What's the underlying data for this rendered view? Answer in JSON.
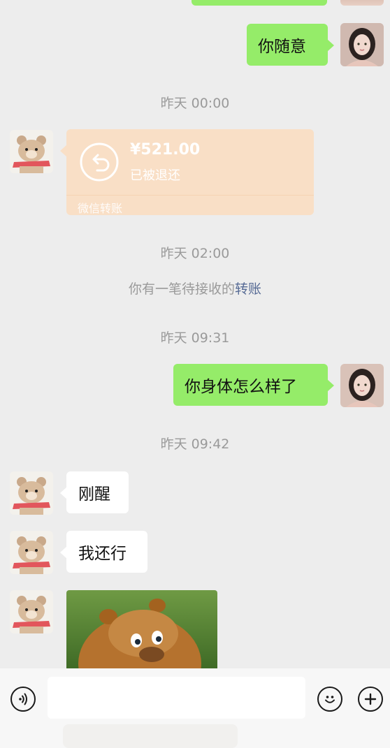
{
  "messages": {
    "me_1": "你随意",
    "me_2": "你身体怎么样了",
    "them_1": "刚醒",
    "them_2": "我还行"
  },
  "timestamps": {
    "t1": "昨天 00:00",
    "t2": "昨天 02:00",
    "t3": "昨天 09:31",
    "t4": "昨天 09:42"
  },
  "transfer": {
    "amount": "¥521.00",
    "status": "已被退还",
    "footer": "微信转账"
  },
  "system_notice": {
    "prefix": "你有一笔待接收的",
    "link": "转账"
  },
  "icons": {
    "voice": "voice-icon",
    "emoji": "emoji-icon",
    "plus": "plus-icon",
    "refund": "refund-arrow-icon"
  },
  "colors": {
    "my_bubble": "#95EC69",
    "their_bubble": "#FFFFFF",
    "transfer_card": "#F9DFC6",
    "link": "#576B95",
    "background": "#EDEDED"
  }
}
